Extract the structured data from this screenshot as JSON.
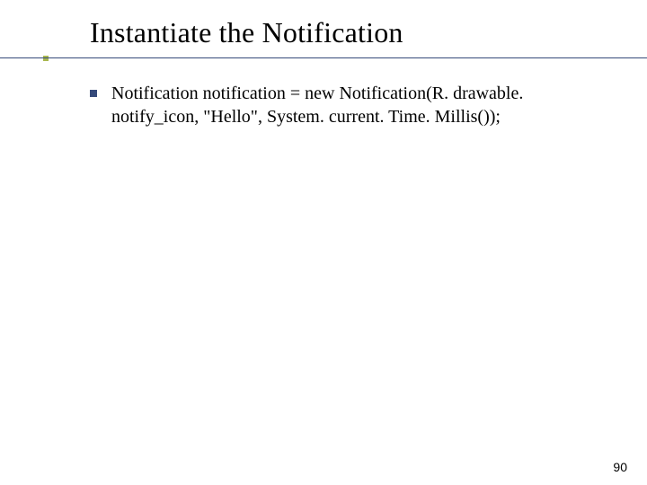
{
  "title": "Instantiate the Notification",
  "bullets": [
    {
      "text": "Notification notification = new Notification(R. drawable. notify_icon, \"Hello\", System. current. Time. Millis());"
    }
  ],
  "page_number": "90"
}
